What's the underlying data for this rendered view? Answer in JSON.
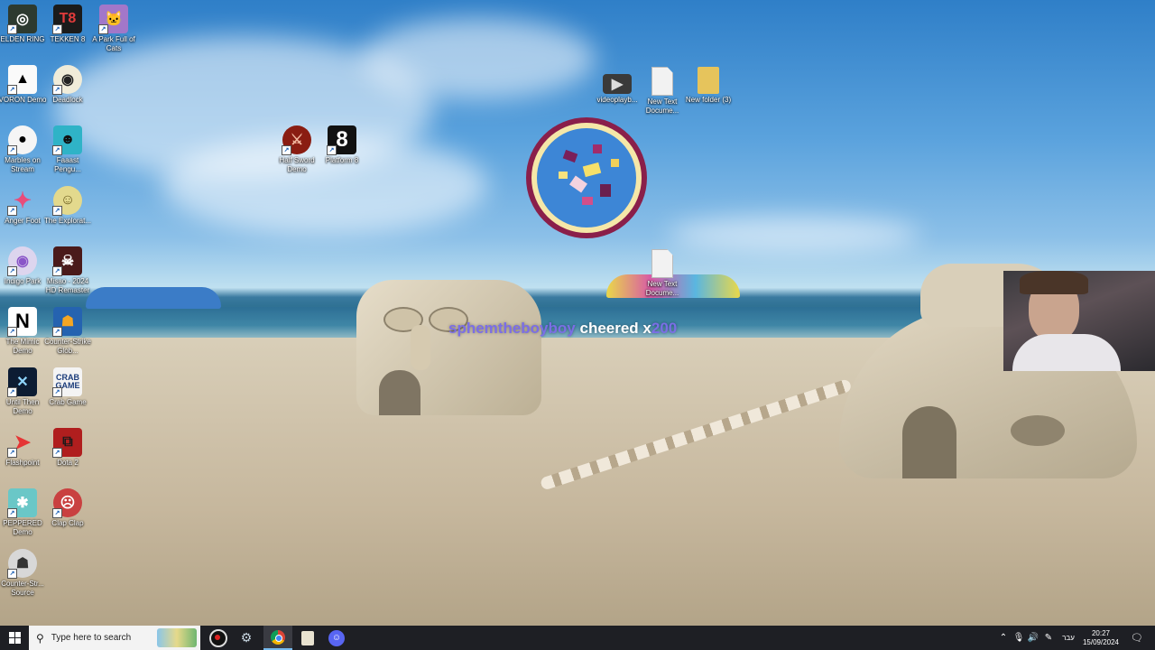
{
  "desktop_icons": [
    {
      "label": "ELDEN RING",
      "icon": "elden-ring-icon"
    },
    {
      "label": "TEKKEN 8",
      "icon": "tekken-icon"
    },
    {
      "label": "A Park Full of Cats",
      "icon": "cat-icon"
    },
    {
      "label": "VORON Demo",
      "icon": "crow-icon"
    },
    {
      "label": "Deadlock",
      "icon": "deadlock-icon"
    },
    {
      "label": "Marbles on Stream",
      "icon": "marbles-icon"
    },
    {
      "label": "Faaast Pengu...",
      "icon": "penguin-icon"
    },
    {
      "label": "Anger Foot",
      "icon": "foot-icon"
    },
    {
      "label": "The Explorat...",
      "icon": "explorer-icon"
    },
    {
      "label": "Indigo Park",
      "icon": "indigo-park-icon"
    },
    {
      "label": "Misao - 2024 HD Remaster",
      "icon": "misao-icon"
    },
    {
      "label": "The Mimic Demo",
      "icon": "n-icon"
    },
    {
      "label": "Counter-Strike Glob...",
      "icon": "csgo-icon"
    },
    {
      "label": "Until Then Demo",
      "icon": "until-then-icon"
    },
    {
      "label": "Crab Game",
      "icon": "crab-game-icon"
    },
    {
      "label": "Flashpoint",
      "icon": "flashpoint-icon"
    },
    {
      "label": "Dota 2",
      "icon": "dota-icon"
    },
    {
      "label": "PEPPERED Demo",
      "icon": "peppered-icon"
    },
    {
      "label": "Clap Clap",
      "icon": "clap-icon"
    },
    {
      "label": "Counter-Str... Source",
      "icon": "cs-source-icon"
    },
    {
      "label": "Half Sword Demo",
      "icon": "half-sword-icon"
    },
    {
      "label": "Platform 8",
      "icon": "platform8-icon"
    },
    {
      "label": "videoplayb...",
      "icon": "video-file-icon"
    },
    {
      "label": "New Text Docume...",
      "icon": "text-file-icon"
    },
    {
      "label": "New folder (3)",
      "icon": "folder-icon"
    },
    {
      "label": "New Text Docume...",
      "icon": "text-file-icon"
    }
  ],
  "overlay": {
    "cheer_user": "sphemtheboyboy",
    "cheer_text": "cheered x",
    "cheer_amount": "200"
  },
  "taskbar": {
    "search_placeholder": "Type here to search",
    "language": "עבר",
    "time": "20:27",
    "date": "15/09/2024",
    "pinned": [
      "obs-icon",
      "steam-icon",
      "chrome-icon",
      "files-icon",
      "discord-icon"
    ]
  },
  "colors": {
    "taskbar": "#1e1f24",
    "accent": "#5b6ad8",
    "cheer_user": "#7b6ee6"
  }
}
